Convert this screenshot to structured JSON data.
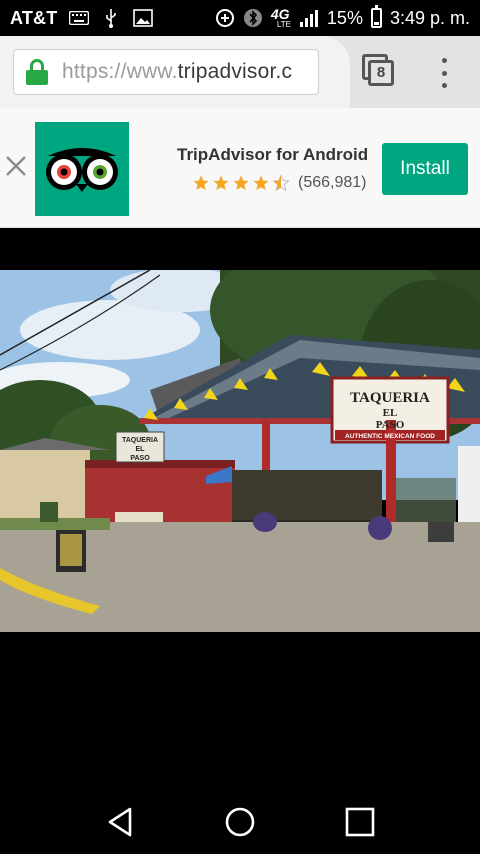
{
  "status_bar": {
    "carrier": "AT&T",
    "network": "4G",
    "network_sub": "LTE",
    "battery": "15%",
    "time": "3:49 p. m."
  },
  "browser": {
    "url_scheme": "https://www.",
    "url_host": "tripadvisor.c",
    "tab_count": "8"
  },
  "app_banner": {
    "title": "TripAdvisor for Android",
    "rating": 4.5,
    "rating_count": "(566,981)",
    "install_label": "Install",
    "colors": {
      "brand": "#00a680",
      "star": "#f5a623"
    }
  },
  "photo": {
    "sign_title_1": "TAQUERIA",
    "sign_title_2": "EL",
    "sign_title_3": "PASO",
    "sign_subtitle": "AUTHENTIC MEXICAN FOOD",
    "small_sign_1": "TAQUERIA",
    "small_sign_2": "EL",
    "small_sign_3": "PASO"
  },
  "nav": {
    "back": "back-icon",
    "home": "home-icon",
    "recents": "recents-icon"
  }
}
